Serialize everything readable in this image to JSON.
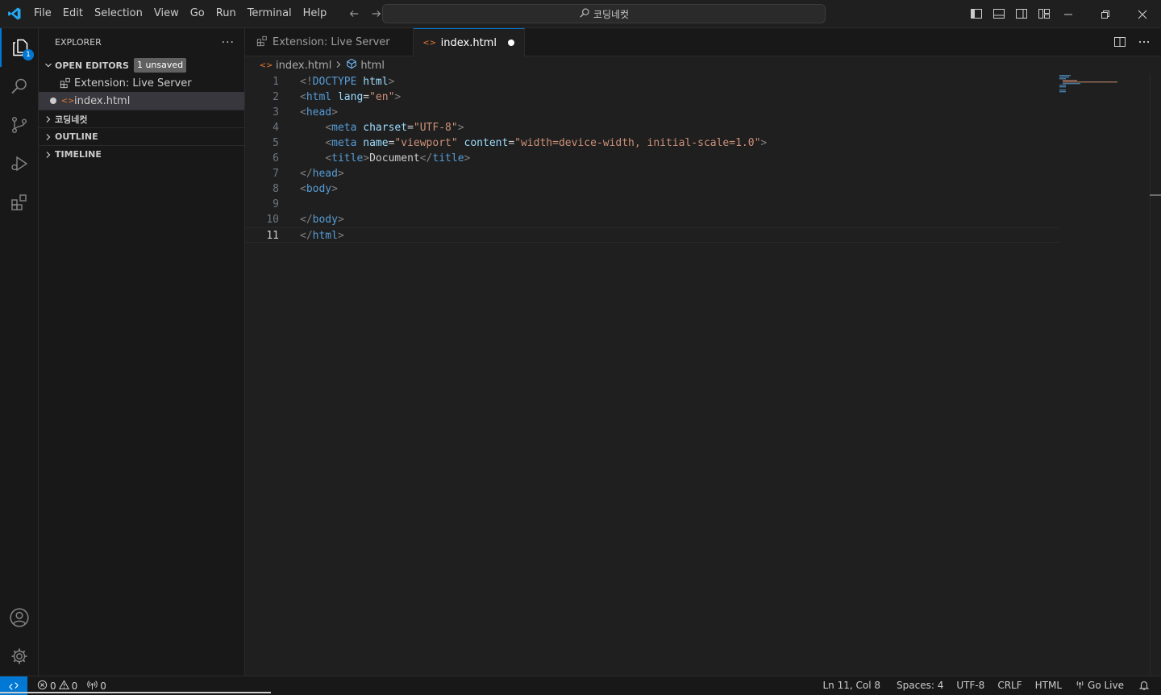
{
  "colors": {
    "accent": "#0078d4",
    "html_icon": "#e37933",
    "tag": "#569cd6",
    "attribute": "#9cdcfe",
    "string": "#ce9178",
    "punctuation": "#808080"
  },
  "titlebar": {
    "menu": [
      "File",
      "Edit",
      "Selection",
      "View",
      "Go",
      "Run",
      "Terminal",
      "Help"
    ],
    "search_text": "코딩네컷"
  },
  "activitybar": {
    "explorer_badge": "1"
  },
  "sidebar": {
    "title": "EXPLORER",
    "more": "···",
    "open_editors": {
      "label": "OPEN EDITORS",
      "badge": "1 unsaved",
      "items": [
        "Extension: Live Server",
        "index.html"
      ]
    },
    "folder_label": "코딩네컷",
    "outline_label": "OUTLINE",
    "timeline_label": "TIMELINE"
  },
  "editor": {
    "tabs": [
      "Extension: Live Server",
      "index.html"
    ],
    "breadcrumb": [
      "index.html",
      "html"
    ],
    "current_line": 11,
    "lines": [
      [
        [
          "punc",
          "<!"
        ],
        [
          "tag",
          "DOCTYPE"
        ],
        [
          "text",
          " "
        ],
        [
          "attr",
          "html"
        ],
        [
          "punc",
          ">"
        ]
      ],
      [
        [
          "punc",
          "<"
        ],
        [
          "tag",
          "html"
        ],
        [
          "text",
          " "
        ],
        [
          "attr",
          "lang"
        ],
        [
          "text",
          "="
        ],
        [
          "str",
          "\"en\""
        ],
        [
          "punc",
          ">"
        ]
      ],
      [
        [
          "punc",
          "<"
        ],
        [
          "tag",
          "head"
        ],
        [
          "punc",
          ">"
        ]
      ],
      [
        [
          "text",
          "    "
        ],
        [
          "punc",
          "<"
        ],
        [
          "tag",
          "meta"
        ],
        [
          "text",
          " "
        ],
        [
          "attr",
          "charset"
        ],
        [
          "text",
          "="
        ],
        [
          "str",
          "\"UTF-8\""
        ],
        [
          "punc",
          ">"
        ]
      ],
      [
        [
          "text",
          "    "
        ],
        [
          "punc",
          "<"
        ],
        [
          "tag",
          "meta"
        ],
        [
          "text",
          " "
        ],
        [
          "attr",
          "name"
        ],
        [
          "text",
          "="
        ],
        [
          "str",
          "\"viewport\""
        ],
        [
          "text",
          " "
        ],
        [
          "attr",
          "content"
        ],
        [
          "text",
          "="
        ],
        [
          "str",
          "\"width=device-width, initial-scale=1.0\""
        ],
        [
          "punc",
          ">"
        ]
      ],
      [
        [
          "text",
          "    "
        ],
        [
          "punc",
          "<"
        ],
        [
          "tag",
          "title"
        ],
        [
          "punc",
          ">"
        ],
        [
          "text",
          "Document"
        ],
        [
          "punc",
          "</"
        ],
        [
          "tag",
          "title"
        ],
        [
          "punc",
          ">"
        ]
      ],
      [
        [
          "punc",
          "</"
        ],
        [
          "tag",
          "head"
        ],
        [
          "punc",
          ">"
        ]
      ],
      [
        [
          "punc",
          "<"
        ],
        [
          "tag",
          "body"
        ],
        [
          "punc",
          ">"
        ]
      ],
      [],
      [
        [
          "punc",
          "</"
        ],
        [
          "tag",
          "body"
        ],
        [
          "punc",
          ">"
        ]
      ],
      [
        [
          "punc",
          "</"
        ],
        [
          "tag",
          "html"
        ],
        [
          "punc",
          ">"
        ]
      ]
    ]
  },
  "statusbar": {
    "errors": "0",
    "warnings": "0",
    "ports": "0",
    "position": "Ln 11, Col 8",
    "spaces": "Spaces: 4",
    "encoding": "UTF-8",
    "eol": "CRLF",
    "language": "HTML",
    "go_live": "Go Live"
  }
}
